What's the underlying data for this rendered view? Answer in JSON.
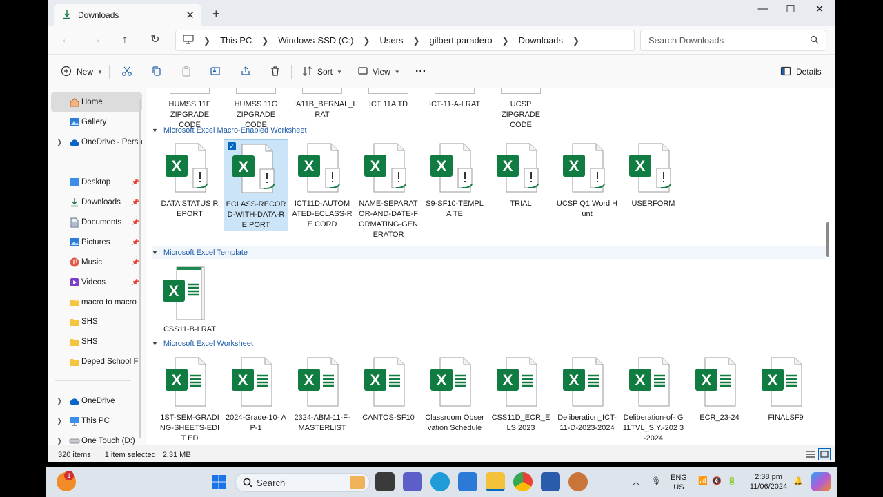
{
  "window": {
    "tab_title": "Downloads",
    "tab_close": "✕",
    "new_tab": "+",
    "minimize": "—",
    "maximize": "☐",
    "close": "✕"
  },
  "address": {
    "crumbs": [
      "This PC",
      "Windows-SSD (C:)",
      "Users",
      "gilbert paradero",
      "Downloads"
    ],
    "search_placeholder": "Search Downloads"
  },
  "toolbar": {
    "new_label": "New",
    "sort_label": "Sort",
    "view_label": "View",
    "more_label": "···",
    "details_label": "Details"
  },
  "sidebar": {
    "home": "Home",
    "gallery": "Gallery",
    "onedrive_personal": "OneDrive - Perso",
    "desktop": "Desktop",
    "downloads": "Downloads",
    "documents": "Documents",
    "pictures": "Pictures",
    "music": "Music",
    "videos": "Videos",
    "macro": "macro to macro",
    "shs1": "SHS",
    "shs2": "SHS",
    "deped": "Deped School F",
    "onedrive": "OneDrive",
    "thispc": "This PC",
    "onetouch": "One Touch (D:)"
  },
  "top_row": [
    "HUMSS 11F ZIPGRADE CODE",
    "HUMSS 11G ZIPGRADE CODE",
    "IA11B_BERNAL_L RAT",
    "ICT 11A TD",
    "ICT-11-A-LRAT",
    "UCSP ZIPGRADE CODE"
  ],
  "groups": {
    "macro": "Microsoft Excel Macro-Enabled Worksheet",
    "template": "Microsoft Excel Template",
    "worksheet": "Microsoft Excel Worksheet"
  },
  "macro_files": [
    "DATA STATUS REPORT",
    "ECLASS-RECORD-WITH-DATA-RE PORT",
    "ICT11D-AUTOM ATED-ECLASS-RE CORD",
    "NAME-SEPARAT OR-AND-DATE-F ORMATING-GEN ERATOR",
    "S9-SF10-TEMPLA TE",
    "TRIAL",
    "UCSP Q1 Word Hunt",
    "USERFORM"
  ],
  "template_files": [
    "CSS11-B-LRAT"
  ],
  "worksheet_files": [
    "1ST-SEM-GRADI NG-SHEETS-EDIT ED",
    "2024-Grade-10- AP-1",
    "2324-ABM-11-F- MASTERLIST",
    "CANTOS-SF10",
    "Classroom Observation Schedule",
    "CSS11D_ECR_ELS 2023",
    "Deliberation_ICT- 11-D-2023-2024",
    "Deliberation-of- G11TVL_S.Y.-202 3-2024",
    "ECR_23-24",
    "FINALSF9"
  ],
  "status": {
    "items": "320 items",
    "selected": "1 item selected",
    "size": "2.31 MB"
  },
  "taskbar": {
    "search": "Search",
    "lang1": "ENG",
    "lang2": "US",
    "time": "2:38 pm",
    "date": "11/06/2024",
    "badge": "1"
  },
  "colors": {
    "excel_green": "#107c41",
    "accent": "#0067c0",
    "selection": "#cce4f7",
    "group_header": "#1b5aa6"
  }
}
